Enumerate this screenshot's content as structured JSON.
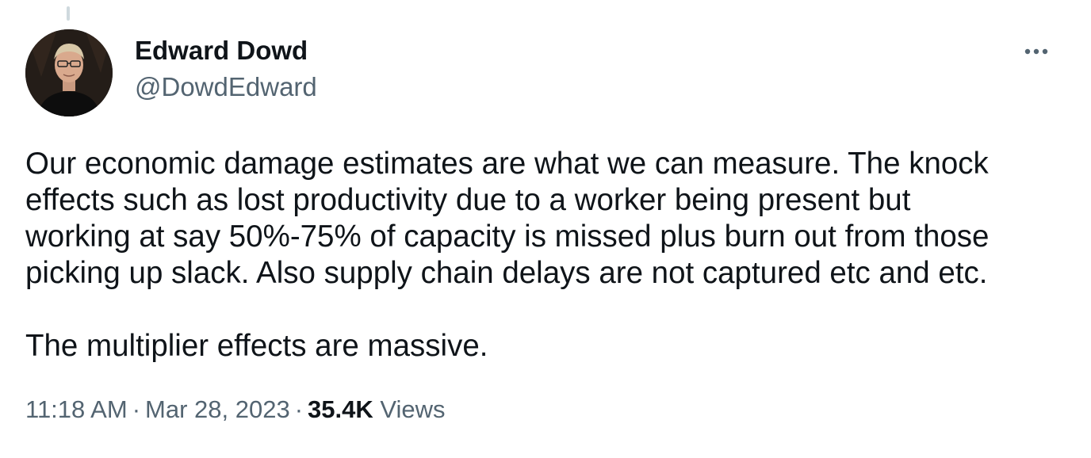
{
  "tweet": {
    "author": {
      "name": "Edward Dowd",
      "handle": "@DowdEdward"
    },
    "paragraphs": [
      "Our economic damage estimates are what we can measure. The knock\neffects such as lost productivity due to a worker being present but\nworking at say 50%-75% of capacity is missed plus burn out from those\npicking up slack. Also supply chain delays are not captured etc and etc.",
      "The multiplier effects are massive."
    ],
    "time": "11:18 AM",
    "date": "Mar 28, 2023",
    "separator": "·",
    "views_count": "35.4K",
    "views_label": "Views",
    "more_icon": "more-horizontal-icon"
  },
  "colors": {
    "text_primary": "#0f1419",
    "text_secondary": "#536471",
    "thread_line": "#cfd9de"
  }
}
